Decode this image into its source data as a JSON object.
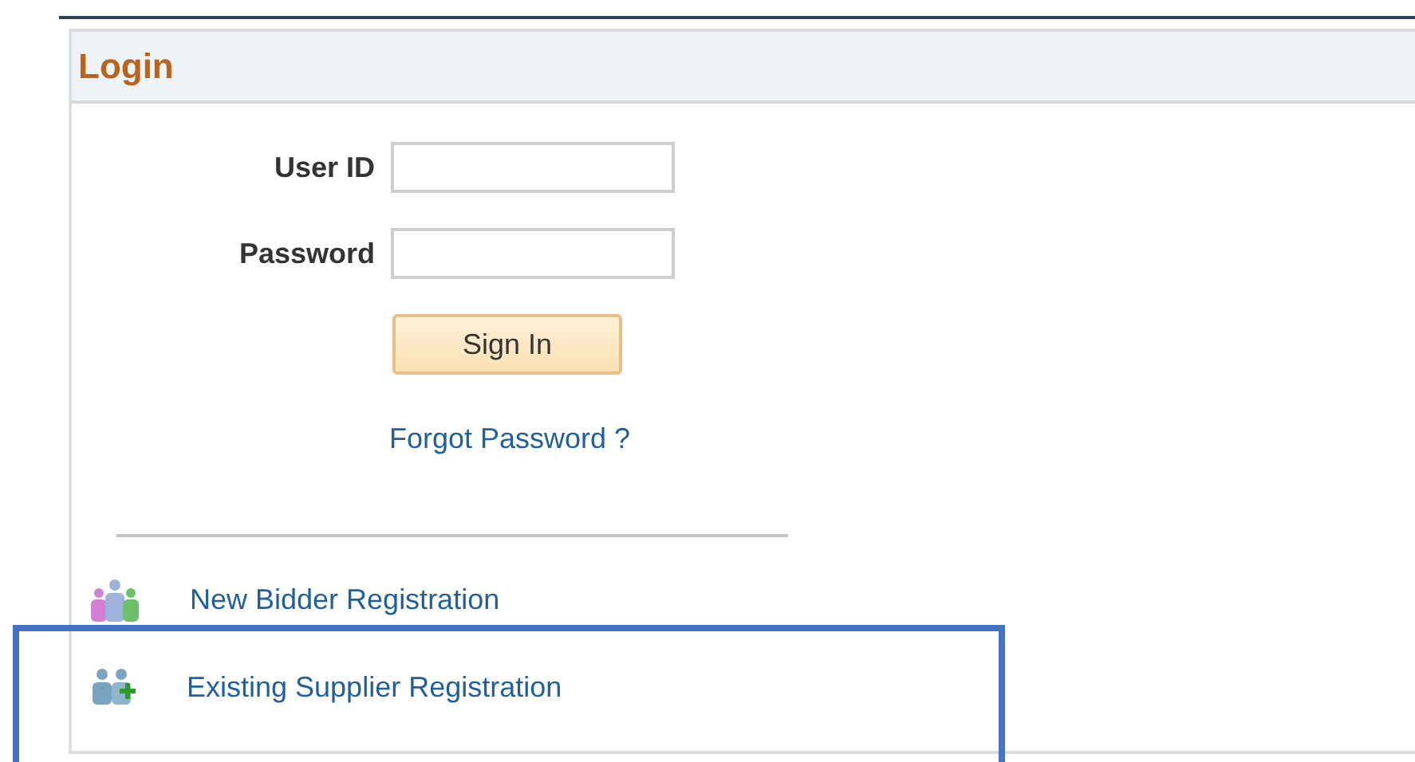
{
  "panel": {
    "title": "Login"
  },
  "fields": [
    {
      "label": "User ID"
    },
    {
      "label": "Password"
    }
  ],
  "sign_in_button": "Sign In",
  "forgot_link": "Forgot Password ?",
  "links": [
    {
      "label": "New Bidder Registration",
      "kind": "new"
    },
    {
      "label": "Existing Supplier Registration",
      "kind": "existing",
      "highlighted": true
    }
  ]
}
